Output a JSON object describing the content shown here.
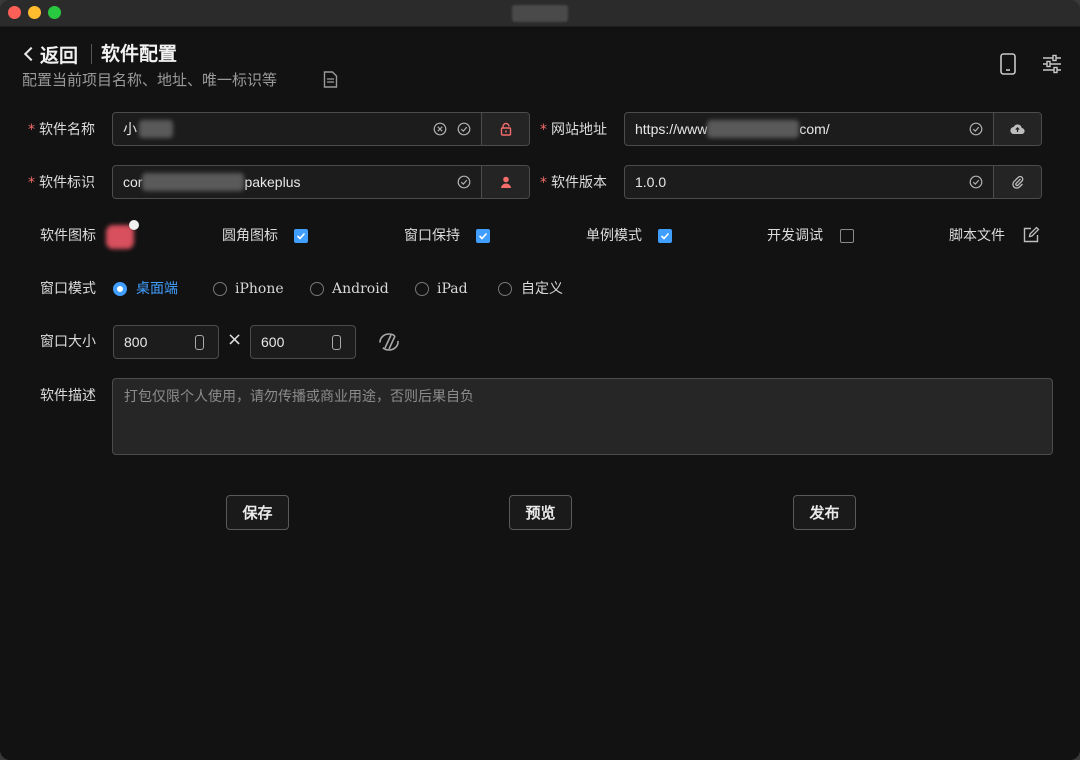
{
  "header": {
    "back_label": "返回",
    "title": "软件配置",
    "subtitle": "配置当前项目名称、地址、唯一标识等"
  },
  "form": {
    "name": {
      "label": "软件名称",
      "value_prefix": "小",
      "required": true
    },
    "url": {
      "label": "网站地址",
      "value_prefix": "https://www",
      "value_suffix": "com/",
      "required": true
    },
    "id": {
      "label": "软件标识",
      "value_prefix": "cor",
      "value_suffix": "pakeplus",
      "required": true
    },
    "version": {
      "label": "软件版本",
      "value": "1.0.0",
      "required": true
    },
    "icon": {
      "label": "软件图标"
    },
    "rounded_icon": {
      "label": "圆角图标",
      "checked": true
    },
    "window_keep": {
      "label": "窗口保持",
      "checked": true
    },
    "single_mode": {
      "label": "单例模式",
      "checked": true
    },
    "dev_debug": {
      "label": "开发调试",
      "checked": false
    },
    "script_file": {
      "label": "脚本文件"
    },
    "window_mode": {
      "label": "窗口模式",
      "options": [
        "桌面端",
        "iPhone",
        "Android",
        "iPad",
        "自定义"
      ],
      "selected": "桌面端"
    },
    "window_size": {
      "label": "窗口大小",
      "width": "800",
      "height": "600",
      "separator": "×"
    },
    "description": {
      "label": "软件描述",
      "placeholder": "打包仅限个人使用，请勿传播或商业用途，否则后果自负"
    }
  },
  "actions": {
    "save": "保存",
    "preview": "预览",
    "publish": "发布"
  },
  "colors": {
    "accent": "#409eff",
    "required": "#f56c6c",
    "background": "#121212",
    "lock_icon": "#f56c6c"
  },
  "icons": [
    "chevron-left-icon",
    "document-icon",
    "mobile-icon",
    "settings-sliders-icon",
    "clear-icon",
    "check-circle-icon",
    "lock-icon",
    "cloud-upload-icon",
    "user-icon",
    "paperclip-icon",
    "edit-icon",
    "swap-icon",
    "spinner-icon"
  ]
}
